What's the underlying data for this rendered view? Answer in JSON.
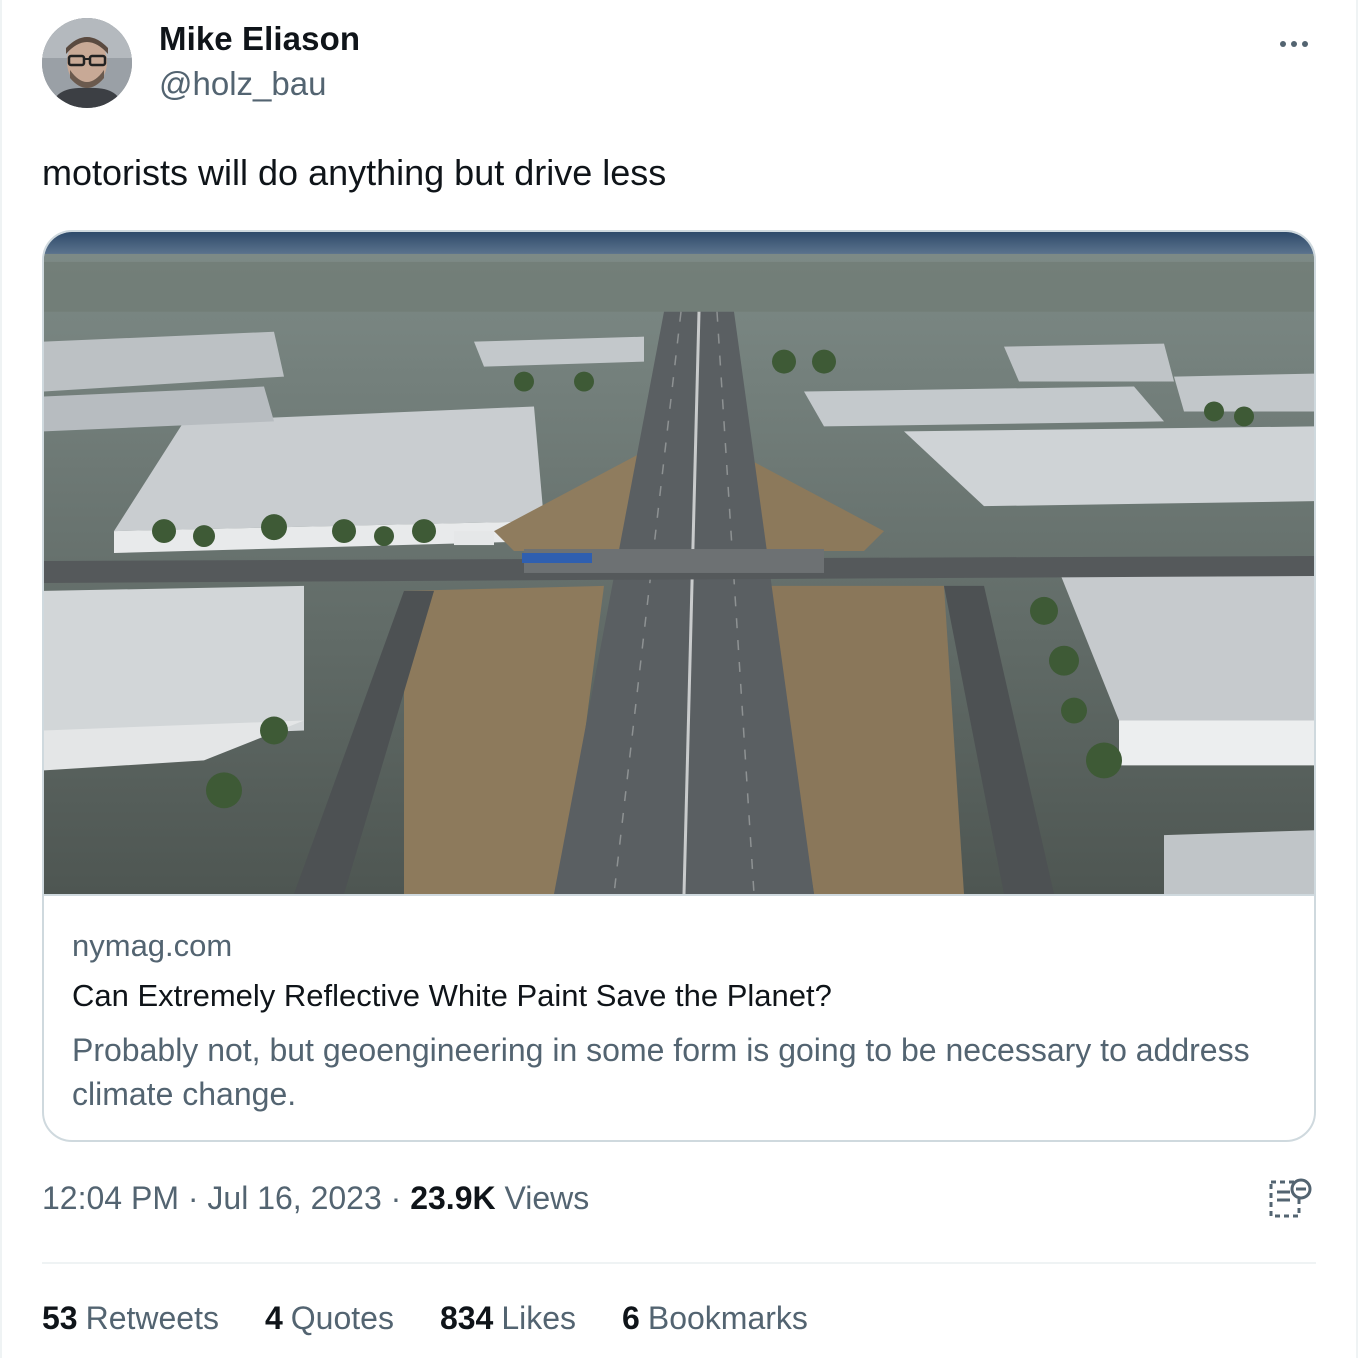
{
  "user": {
    "name": "Mike Eliason",
    "handle": "@holz_bau"
  },
  "tweet": {
    "text": "motorists will do anything but drive less"
  },
  "link_card": {
    "domain": "nymag.com",
    "title": "Can Extremely Reflective White Paint Save the Planet?",
    "description": "Probably not, but geoengineering in some form is going to be necessary to address climate change."
  },
  "meta": {
    "time": "12:04 PM",
    "date": "Jul 16, 2023",
    "separator": "·",
    "views_count": "23.9K",
    "views_label": "Views"
  },
  "stats": {
    "retweets": {
      "count": "53",
      "label": "Retweets"
    },
    "quotes": {
      "count": "4",
      "label": "Quotes"
    },
    "likes": {
      "count": "834",
      "label": "Likes"
    },
    "bookmarks": {
      "count": "6",
      "label": "Bookmarks"
    }
  },
  "icons": {
    "more": "more-icon",
    "analytics": "analytics-icon"
  },
  "colors": {
    "text_primary": "#0f1419",
    "text_secondary": "#536471",
    "border": "#cfd9de"
  }
}
